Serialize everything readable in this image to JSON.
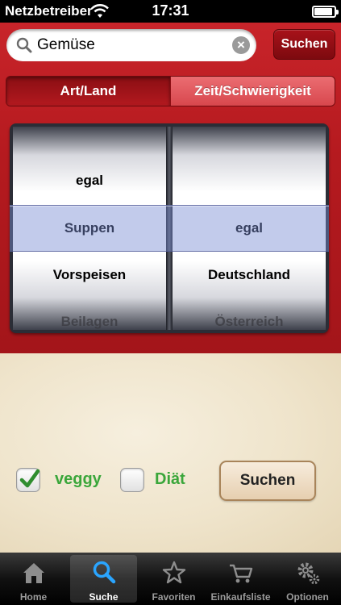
{
  "status_bar": {
    "carrier": "Netzbetreiber",
    "time": "17:31",
    "battery_level": 0.85
  },
  "search": {
    "query": "Gemüse",
    "button_label": "Suchen"
  },
  "segments": [
    {
      "label": "Art/Land",
      "selected": true
    },
    {
      "label": "Zeit/Schwierigkeit",
      "selected": false
    }
  ],
  "picker": {
    "left_rows": [
      "egal",
      "Suppen",
      "Vorspeisen",
      "Beilagen"
    ],
    "right_rows": [
      "",
      "egal",
      "Deutschland",
      "Österreich"
    ]
  },
  "filters": {
    "veggy": {
      "label": "veggy",
      "checked": true
    },
    "diaet": {
      "label": "Diät",
      "checked": false
    },
    "button_label": "Suchen"
  },
  "tabs": [
    {
      "label": "Home",
      "icon": "home-icon"
    },
    {
      "label": "Suche",
      "icon": "search-icon",
      "active": true
    },
    {
      "label": "Favoriten",
      "icon": "star-icon"
    },
    {
      "label": "Einkaufsliste",
      "icon": "cart-icon"
    },
    {
      "label": "Optionen",
      "icon": "gear-icon"
    }
  ],
  "colors": {
    "header_red": "#b51a1f",
    "accent_green": "#3aa63a",
    "selection_blue": "#7b8cd2"
  }
}
